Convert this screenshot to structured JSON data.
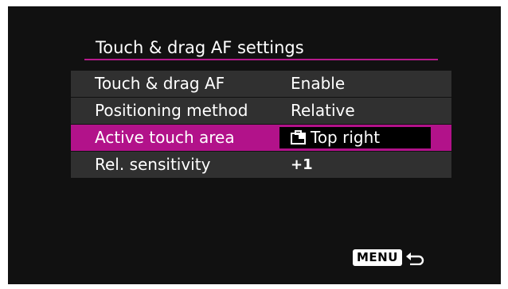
{
  "screen_title": "Touch & drag AF settings",
  "menu_items": [
    {
      "label": "Touch & drag AF",
      "value": "Enable"
    },
    {
      "label": "Positioning method",
      "value": "Relative"
    },
    {
      "label": "Active touch area",
      "value": "Top right",
      "icon": "touch-area-top-right-icon",
      "selected": true
    },
    {
      "label": "Rel. sensitivity",
      "value": "+1"
    }
  ],
  "footer": {
    "menu_button_label": "MENU",
    "back_icon": "return-arrow-icon"
  },
  "colors": {
    "accent": "#b2128a",
    "row_background": "#303030",
    "screen_background": "#111111"
  }
}
